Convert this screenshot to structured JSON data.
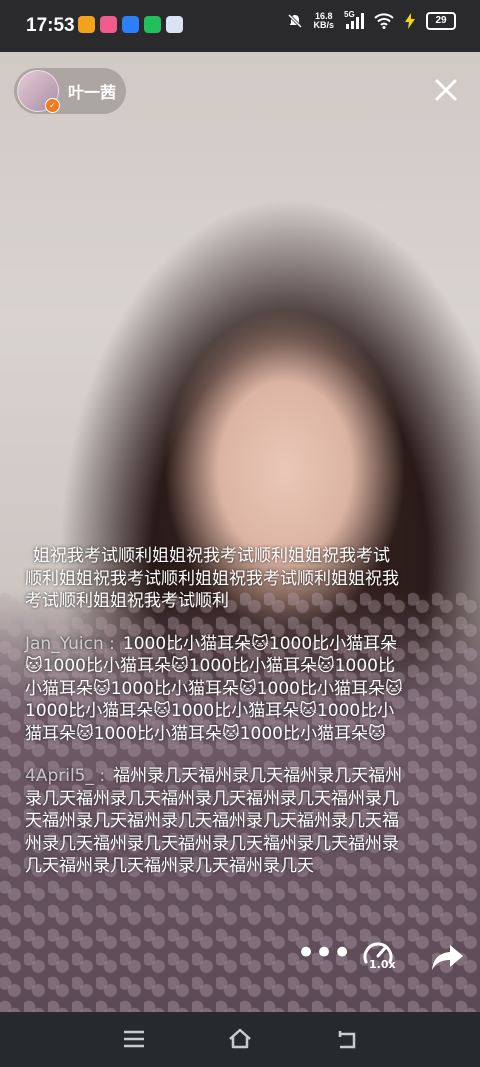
{
  "status_bar": {
    "time": "17:53",
    "network_speed": "16.8",
    "network_unit": "KB/s",
    "signal_label": "5G",
    "battery": "29"
  },
  "author": {
    "name": "叶一茜"
  },
  "comments": [
    {
      "user": "",
      "text": "姐祝我考试顺利姐姐祝我考试顺利姐姐祝我考试顺利姐姐祝我考试顺利姐姐祝我考试顺利姐姐祝我考试顺利姐姐祝我考试顺利"
    },
    {
      "user": "Jan_Yuicn :",
      "text": "1000比小猫耳朵🐱1000比小猫耳朵🐱1000比小猫耳朵🐱1000比小猫耳朵🐱1000比小猫耳朵🐱1000比小猫耳朵🐱1000比小猫耳朵🐱1000比小猫耳朵🐱1000比小猫耳朵🐱1000比小猫耳朵🐱1000比小猫耳朵🐱1000比小猫耳朵🐱"
    },
    {
      "user": "4April5_ :",
      "text": "福州录几天福州录几天福州录几天福州录几天福州录几天福州录几天福州录几天福州录几天福州录几天福州录几天福州录几天福州录几天福州录几天福州录几天福州录几天福州录几天福州录几天福州录几天福州录几天福州录几天"
    }
  ],
  "controls": {
    "more": "•••",
    "playback_speed": "1.0x"
  },
  "icons": {
    "close": "close-icon",
    "more": "more-icon",
    "speed": "playback-speed-icon",
    "share": "share-icon",
    "menu": "menu-icon",
    "home": "home-icon",
    "back": "back-icon"
  },
  "colors": {
    "verified": "#f07b1e",
    "navbar": "#262a2e",
    "status_bar": "#2a2a2c"
  }
}
